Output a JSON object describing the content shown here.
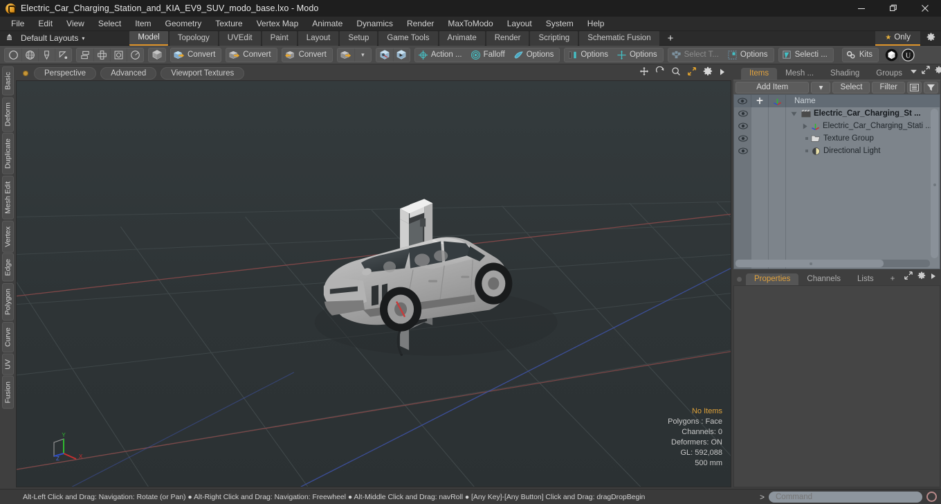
{
  "window": {
    "title": "Electric_Car_Charging_Station_and_KIA_EV9_SUV_modo_base.lxo - Modo",
    "minimize": "minimize-icon",
    "maximize": "restore-icon",
    "close": "close-icon"
  },
  "menubar": {
    "items": [
      "File",
      "Edit",
      "View",
      "Select",
      "Item",
      "Geometry",
      "Texture",
      "Vertex Map",
      "Animate",
      "Dynamics",
      "Render",
      "MaxToModo",
      "Layout",
      "System",
      "Help"
    ]
  },
  "layoutbar": {
    "preset_label": "Default Layouts",
    "caret": "▾",
    "tabs": [
      {
        "label": "Model",
        "active": true
      },
      {
        "label": "Topology",
        "active": false
      },
      {
        "label": "UVEdit",
        "active": false
      },
      {
        "label": "Paint",
        "active": false
      },
      {
        "label": "Layout",
        "active": false
      },
      {
        "label": "Setup",
        "active": false
      },
      {
        "label": "Game Tools",
        "active": false
      },
      {
        "label": "Animate",
        "active": false
      },
      {
        "label": "Render",
        "active": false
      },
      {
        "label": "Scripting",
        "active": false
      },
      {
        "label": "Schematic Fusion",
        "active": false
      }
    ],
    "add_tab": "+",
    "only_label": "Only"
  },
  "toolbar": {
    "groups": [
      {
        "name": "primitives",
        "buttons": [
          {
            "name": "sphere-tool",
            "label": ""
          },
          {
            "name": "globe-tool",
            "label": ""
          },
          {
            "name": "pen-tool",
            "label": ""
          },
          {
            "name": "curve-tool",
            "label": ""
          }
        ]
      },
      {
        "name": "arrange",
        "buttons": [
          {
            "name": "align-tool",
            "label": ""
          },
          {
            "name": "center-tool",
            "label": ""
          },
          {
            "name": "bound-tool",
            "label": ""
          },
          {
            "name": "radial-tool",
            "label": ""
          }
        ]
      },
      {
        "name": "mesh-mode",
        "buttons": [
          {
            "name": "cube-tool",
            "label": ""
          }
        ]
      },
      {
        "name": "convert-1",
        "buttons": [
          {
            "name": "convert-button",
            "label": "Convert"
          }
        ]
      },
      {
        "name": "convert-2",
        "buttons": [
          {
            "name": "convert-button",
            "label": "Convert"
          }
        ]
      },
      {
        "name": "convert-3",
        "buttons": [
          {
            "name": "convert-button",
            "label": "Convert"
          }
        ]
      },
      {
        "name": "convert-drop",
        "buttons": [
          {
            "name": "convert-icon-button",
            "label": ""
          },
          {
            "name": "convert-dropdown",
            "label": "▾"
          }
        ]
      },
      {
        "name": "snap-group",
        "buttons": [
          {
            "name": "snap-a-button",
            "label": ""
          },
          {
            "name": "snap-b-button",
            "label": ""
          }
        ]
      },
      {
        "name": "action-group",
        "buttons": [
          {
            "name": "action-center-button",
            "label": "Action  ..."
          },
          {
            "name": "falloff-button",
            "label": "Falloff"
          },
          {
            "name": "tool-options-button",
            "label": "Options"
          }
        ]
      },
      {
        "name": "symmetry-group",
        "buttons": [
          {
            "name": "symmetry-options-button",
            "label": "Options"
          },
          {
            "name": "snapping-options-button",
            "label": "Options"
          }
        ]
      },
      {
        "name": "select-through-group",
        "buttons": [
          {
            "name": "select-through-button",
            "label": "Select T...",
            "dim": true
          },
          {
            "name": "selection-options-button",
            "label": "Options"
          }
        ]
      },
      {
        "name": "selection-set-group",
        "buttons": [
          {
            "name": "selection-set-button",
            "label": "Selecti ..."
          }
        ]
      },
      {
        "name": "kits-group",
        "buttons": [
          {
            "name": "kits-button",
            "label": "Kits"
          }
        ]
      },
      {
        "name": "engine-group",
        "buttons": [
          {
            "name": "unity-export-button",
            "label": ""
          },
          {
            "name": "unreal-export-button",
            "label": ""
          }
        ]
      }
    ]
  },
  "left_tabs": [
    "Basic",
    "Deform",
    "Duplicate",
    "Mesh Edit",
    "Vertex",
    "Edge",
    "Polygon",
    "Curve",
    "UV",
    "Fusion"
  ],
  "viewport": {
    "buttons": [
      "Perspective",
      "Advanced",
      "Viewport Textures"
    ],
    "tool_icons": [
      "pan-icon",
      "rotate-icon",
      "zoom-icon",
      "fit-icon",
      "settings-icon",
      "more-icon"
    ],
    "info": {
      "selection": "No Items",
      "polygons": "Polygons : Face",
      "channels": "Channels: 0",
      "deformers": "Deformers: ON",
      "gl": "GL: 592,088",
      "scale": "500 mm"
    },
    "axis_labels": {
      "x": "X",
      "y": "Y",
      "z": "Z"
    },
    "colors": {
      "background": "#2e3436",
      "grid": "#4a5254",
      "x_axis": "#a05050",
      "z_axis": "#4a5fa8",
      "y_axis": "#5fa05f"
    }
  },
  "right_panel": {
    "tabs": [
      {
        "label": "Items",
        "active": true
      },
      {
        "label": "Mesh ...",
        "active": false
      },
      {
        "label": "Shading",
        "active": false
      },
      {
        "label": "Groups",
        "active": false
      }
    ],
    "toolbar": {
      "add_item": "Add Item",
      "add_item_caret": "▾",
      "select": "Select",
      "filter": "Filter",
      "list_icon": "list-options-icon",
      "funnel_icon": "funnel-icon"
    },
    "list_header": {
      "eye": "visibility-icon",
      "lock": "lock-icon",
      "axis": "transform-icon",
      "name": "Name"
    },
    "items": [
      {
        "name": "Electric_Car_Charging_St ...",
        "icon": "scene-icon",
        "depth": 0,
        "expanded": true,
        "bold": true
      },
      {
        "name": "Electric_Car_Charging_Stati ...",
        "icon": "mesh-icon",
        "depth": 1,
        "expanded": false,
        "bold": false
      },
      {
        "name": "Texture Group",
        "icon": "folder-icon",
        "depth": 1,
        "expanded": null,
        "bold": false
      },
      {
        "name": "Directional Light",
        "icon": "light-icon",
        "depth": 1,
        "expanded": null,
        "bold": false
      }
    ],
    "bottom_tabs": [
      {
        "label": "Properties",
        "active": true
      },
      {
        "label": "Channels",
        "active": false
      },
      {
        "label": "Lists",
        "active": false
      },
      {
        "label": "+",
        "active": false
      }
    ]
  },
  "statusbar": {
    "hints": "Alt-Left Click and Drag: Navigation: Rotate (or Pan) ● Alt-Right Click and Drag: Navigation: Freewheel ● Alt-Middle Click and Drag: navRoll ● [Any Key]-[Any Button] Click and Drag: dragDropBegin",
    "command_prompt": ">",
    "command_placeholder": "Command",
    "command_value": "",
    "record_icon": "record-icon"
  }
}
